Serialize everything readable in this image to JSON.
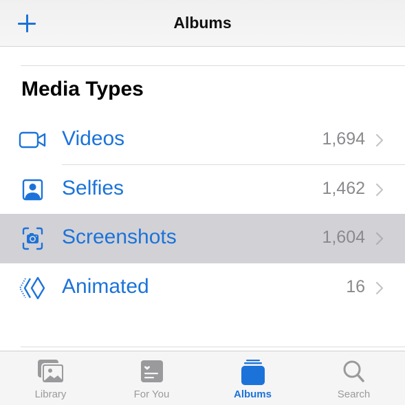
{
  "navbar": {
    "title": "Albums",
    "add_icon": "plus-icon"
  },
  "section": {
    "title": "Media Types"
  },
  "media_types": [
    {
      "label": "Videos",
      "count": "1,694",
      "icon": "video-camera-icon",
      "highlighted": false
    },
    {
      "label": "Selfies",
      "count": "1,462",
      "icon": "selfie-portrait-icon",
      "highlighted": false
    },
    {
      "label": "Screenshots",
      "count": "1,604",
      "icon": "screenshot-camera-icon",
      "highlighted": true
    },
    {
      "label": "Animated",
      "count": "16",
      "icon": "animated-layers-icon",
      "highlighted": false
    }
  ],
  "tabbar": {
    "tabs": [
      {
        "label": "Library",
        "icon": "photo-library-icon",
        "active": false
      },
      {
        "label": "For You",
        "icon": "for-you-heart-card-icon",
        "active": false
      },
      {
        "label": "Albums",
        "icon": "albums-stack-icon",
        "active": true
      },
      {
        "label": "Search",
        "icon": "magnifier-search-icon",
        "active": false
      }
    ]
  },
  "colors": {
    "accent": "#1b73d9",
    "highlight_row": "#d2d1d6",
    "secondary_text": "#8a8a8e",
    "tab_inactive": "#9a9a9c"
  }
}
